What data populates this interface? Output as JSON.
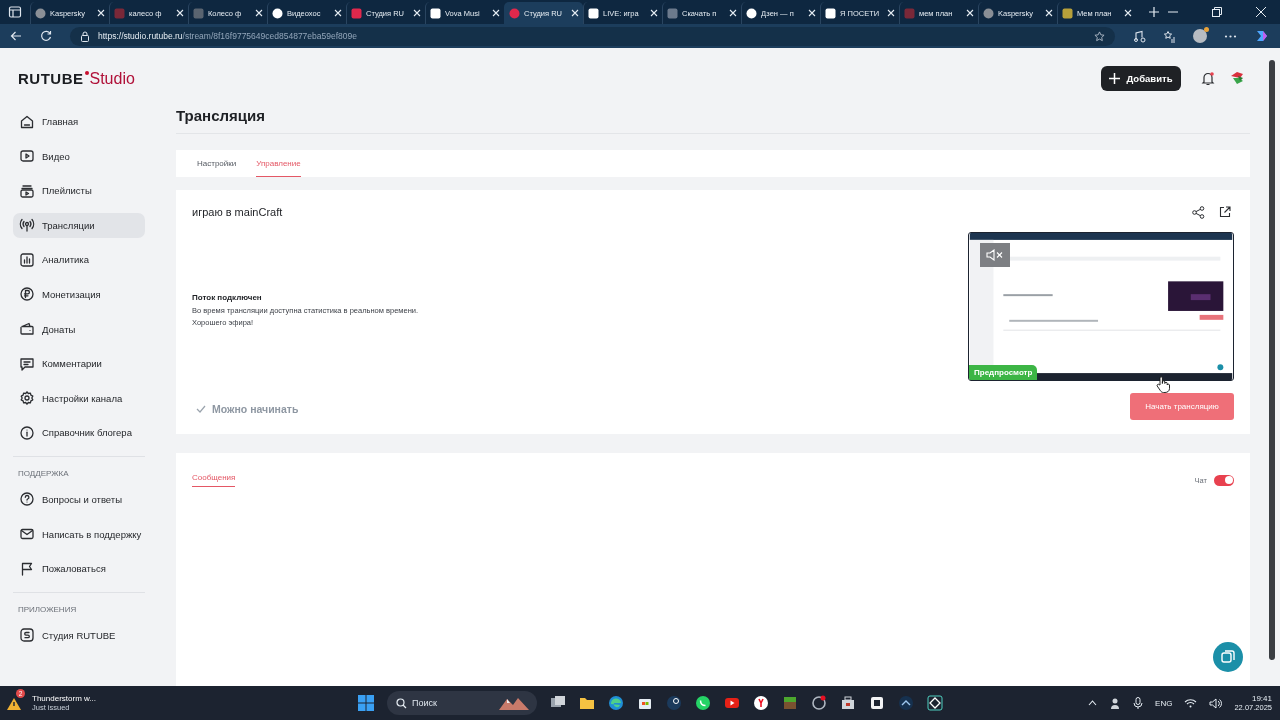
{
  "browser": {
    "tabs": [
      {
        "title": "Kaspersky",
        "selected": false
      },
      {
        "title": "калесо ф",
        "selected": false
      },
      {
        "title": "Колесо ф",
        "selected": false
      },
      {
        "title": "Видеохос",
        "selected": false
      },
      {
        "title": "Студия RU",
        "selected": false
      },
      {
        "title": "Vova Musi",
        "selected": false
      },
      {
        "title": "Студия RU",
        "selected": true
      },
      {
        "title": "LIVE: игра",
        "selected": false
      },
      {
        "title": "Скачать п",
        "selected": false
      },
      {
        "title": "Дзен — п",
        "selected": false
      },
      {
        "title": "Я ПОСЕТИ",
        "selected": false
      },
      {
        "title": "мем план",
        "selected": false
      },
      {
        "title": "Kaspersky",
        "selected": false
      },
      {
        "title": "Мем план",
        "selected": false
      }
    ],
    "url": {
      "host": "https://studio.rutube.ru",
      "path": "/stream/8f16f9775649ced854877eba59ef809e"
    }
  },
  "sidebar": {
    "logo": {
      "brand": "RUTUBE",
      "product": "Studio"
    },
    "items": [
      {
        "label": "Главная",
        "selected": false
      },
      {
        "label": "Видео",
        "selected": false
      },
      {
        "label": "Плейлисты",
        "selected": false
      },
      {
        "label": "Трансляции",
        "selected": true
      },
      {
        "label": "Аналитика",
        "selected": false
      },
      {
        "label": "Монетизация",
        "selected": false
      },
      {
        "label": "Донаты",
        "selected": false
      },
      {
        "label": "Комментарии",
        "selected": false
      },
      {
        "label": "Настройки канала",
        "selected": false
      },
      {
        "label": "Справочник блогера",
        "selected": false
      }
    ],
    "sections": [
      {
        "heading": "ПОДДЕРЖКА",
        "items": [
          {
            "label": "Вопросы и ответы",
            "selected": false
          },
          {
            "label": "Написать в поддержку",
            "selected": false
          },
          {
            "label": "Пожаловаться",
            "selected": false
          }
        ]
      },
      {
        "heading": "ПРИЛОЖЕНИЯ",
        "items": [
          {
            "label": "Студия RUTUBE",
            "selected": false
          }
        ]
      }
    ]
  },
  "header": {
    "add_button": "Добавить"
  },
  "page_title": "Трансляция",
  "tabs": [
    {
      "label": "Настройки",
      "selected": false
    },
    {
      "label": "Управление",
      "selected": true
    }
  ],
  "stream": {
    "title": "играю в mainCraft",
    "status_heading": "Поток подключен",
    "status_lines": [
      "Во время трансляции доступна статистика в реальном времени.",
      "Хорошего эфира!"
    ],
    "ready": "Можно начинать",
    "preview_label": "Предпросмотр",
    "start_button": "Начать трансляцию"
  },
  "messages": {
    "tabs": [
      {
        "label": "Сообщения",
        "selected": true
      }
    ],
    "chat": {
      "label": "Чат",
      "on": true
    }
  },
  "taskbar": {
    "notification": {
      "badge": "2",
      "title": "Thunderstorm w...",
      "subtitle": "Just issued"
    },
    "search": {
      "placeholder": "Поиск"
    },
    "language": "ENG",
    "time": "19:41",
    "date": "22.07.2025"
  }
}
